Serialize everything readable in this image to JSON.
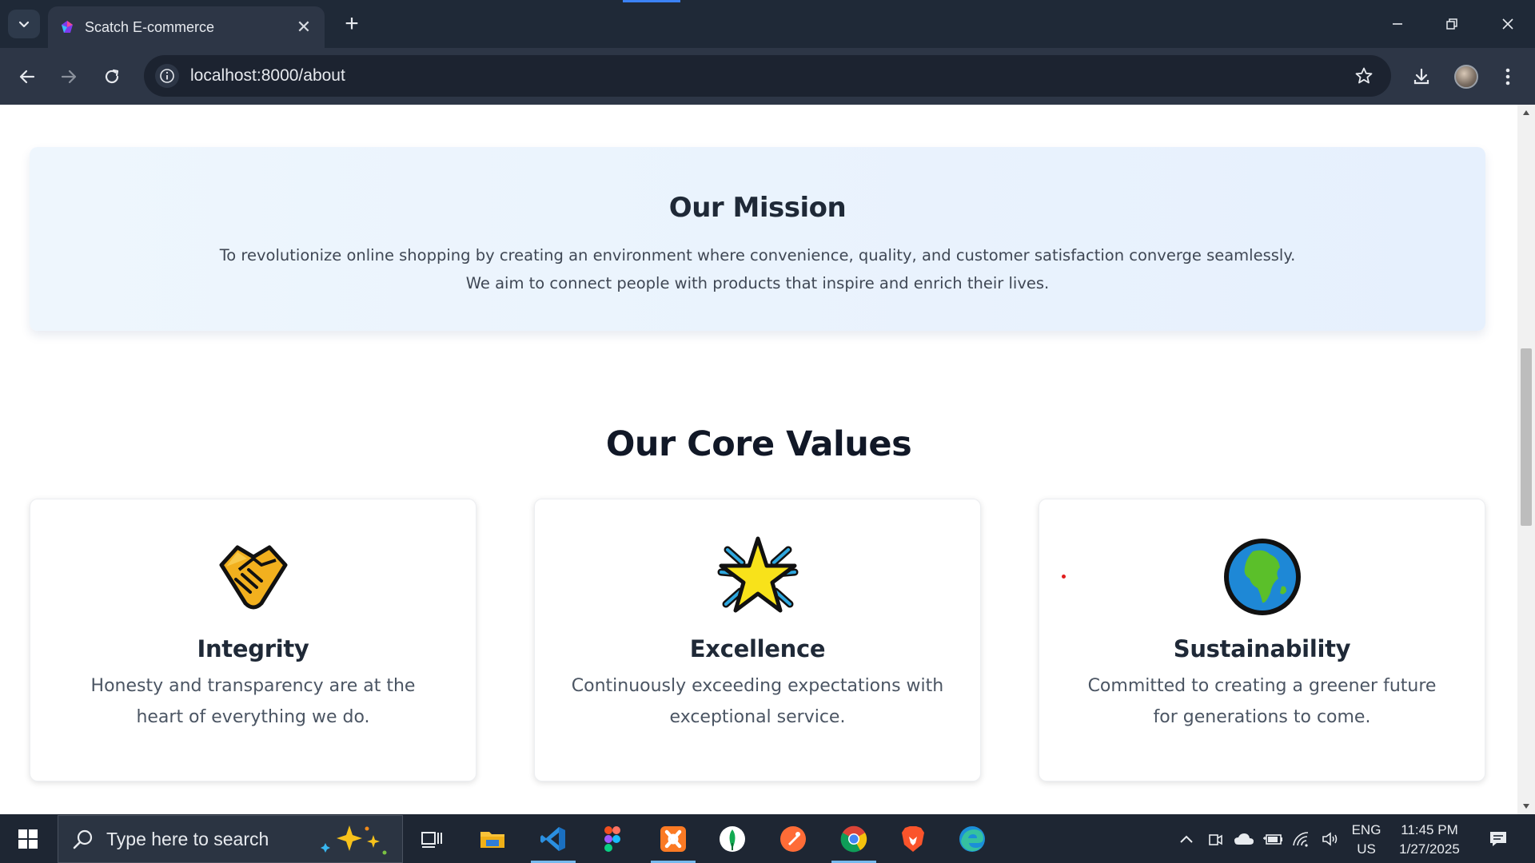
{
  "browser": {
    "tab_title": "Scatch E-commerce",
    "url": "localhost:8000/about"
  },
  "mission": {
    "title": "Our Mission",
    "text": "To revolutionize online shopping by creating an environment where convenience, quality, and customer satisfaction converge seamlessly. We aim to connect people with products that inspire and enrich their lives."
  },
  "values": {
    "title": "Our Core Values",
    "cards": [
      {
        "icon": "handshake-icon",
        "title": "Integrity",
        "text": "Honesty and transparency are at the heart of everything we do."
      },
      {
        "icon": "glowing-star-icon",
        "title": "Excellence",
        "text": "Continuously exceeding expectations with exceptional service."
      },
      {
        "icon": "globe-africa-icon",
        "title": "Sustainability",
        "text": "Committed to creating a greener future for generations to come."
      }
    ]
  },
  "taskbar": {
    "search_placeholder": "Type here to search",
    "lang_line1": "ENG",
    "lang_line2": "US",
    "time": "11:45 PM",
    "date": "1/27/2025"
  }
}
